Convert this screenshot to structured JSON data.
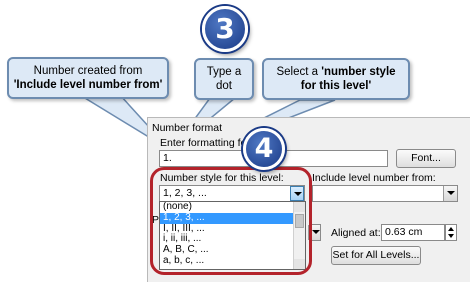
{
  "callouts": {
    "number_created": {
      "line1": "Number created from",
      "line2": "'Include level number from'"
    },
    "type_dot": {
      "line1": "Type a",
      "line2": "dot"
    },
    "select_style": {
      "line1_prefix": "Select a ",
      "line1_bold": "'number style",
      "line2": "for this level'"
    }
  },
  "steps": {
    "step3": "3",
    "step4": "4"
  },
  "dialog": {
    "section_title": "Number format",
    "enter_formatting_label": "Enter formatting fo",
    "formatting_value": "1.",
    "font_button": "Font...",
    "number_style_label": "Number style for this level:",
    "include_level_label": "Include level number from:",
    "number_style_value": "1, 2, 3, ...",
    "list_items": [
      "(none)",
      "1, 2, 3, ...",
      "I, II, III, ...",
      "i, ii, iii, ...",
      "A, B, C, ...",
      "a, b, c, ..."
    ],
    "selected_index": 1,
    "position_label_partial": "P",
    "aligned_at_label": "Aligned at:",
    "aligned_at_value": "0.63 cm",
    "set_all_levels_button": "Set for All Levels..."
  },
  "colors": {
    "callout_fill": "#dde9f6",
    "callout_border": "#6d8cb0",
    "step_circle": "#1a3a86",
    "highlight_outline": "#b3232b",
    "selection": "#3399ff"
  }
}
